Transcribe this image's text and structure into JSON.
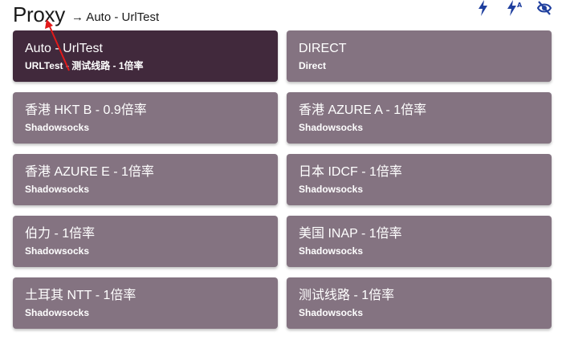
{
  "header": {
    "title": "Proxy",
    "selected": "→ Auto - UrlTest"
  },
  "toolbar": {
    "icons": [
      "lightning-icon",
      "lightning-a-icon",
      "eye-off-icon"
    ]
  },
  "colors": {
    "card": "#847381",
    "card_active": "#41293c",
    "accent": "#1f3f9e",
    "annotation": "#e21a1a"
  },
  "proxies": [
    {
      "name": "Auto - UrlTest",
      "type": "URLTest - 测试线路 - 1倍率",
      "active": true
    },
    {
      "name": "DIRECT",
      "type": "Direct",
      "active": false
    },
    {
      "name": "香港 HKT B - 0.9倍率",
      "type": "Shadowsocks",
      "active": false
    },
    {
      "name": "香港 AZURE A - 1倍率",
      "type": "Shadowsocks",
      "active": false
    },
    {
      "name": "香港 AZURE E - 1倍率",
      "type": "Shadowsocks",
      "active": false
    },
    {
      "name": "日本 IDCF - 1倍率",
      "type": "Shadowsocks",
      "active": false
    },
    {
      "name": "伯力 - 1倍率",
      "type": "Shadowsocks",
      "active": false
    },
    {
      "name": "美国 INAP - 1倍率",
      "type": "Shadowsocks",
      "active": false
    },
    {
      "name": "土耳其 NTT - 1倍率",
      "type": "Shadowsocks",
      "active": false
    },
    {
      "name": "测试线路 - 1倍率",
      "type": "Shadowsocks",
      "active": false
    }
  ]
}
